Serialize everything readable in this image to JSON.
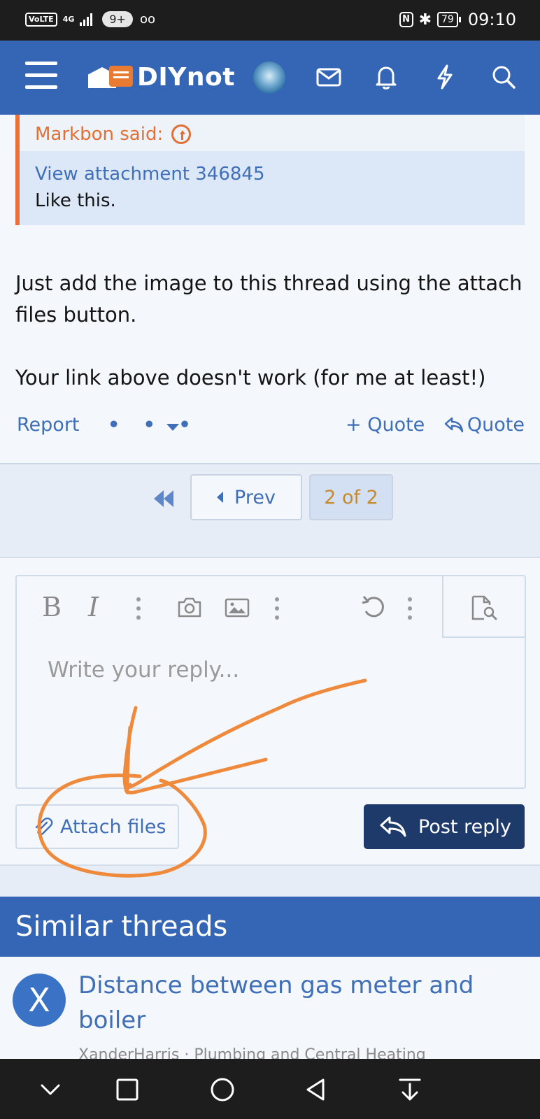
{
  "status_bar": {
    "volte": "VoLTE",
    "network": "4G",
    "notifications": "9+",
    "voicemail": "oo",
    "nfc": "N",
    "battery": "79",
    "time": "09:10"
  },
  "header": {
    "logo_text": "DIYnot",
    "icons": [
      "menu-icon",
      "avatar",
      "envelope-icon",
      "bell-icon",
      "lightning-icon",
      "search-icon"
    ]
  },
  "quote": {
    "author_line": "Markbon said:",
    "attachment_link": "View attachment 346845",
    "text": "Like this."
  },
  "post": {
    "paragraph1": "Just add the image to this thread using the attach files button.",
    "paragraph2": "Your link above doesn't work (for me at least!)"
  },
  "actions": {
    "report": "Report",
    "more": "• • •",
    "multi_quote": "+ Quote",
    "quote": "Quote"
  },
  "pagination": {
    "prev": "Prev",
    "current": "2 of 2"
  },
  "editor": {
    "bold": "B",
    "italic": "I",
    "placeholder": "Write your reply..."
  },
  "buttons": {
    "attach_files": "Attach files",
    "post_reply": "Post reply"
  },
  "similar_threads": {
    "heading": "Similar threads",
    "items": [
      {
        "avatar_letter": "X",
        "title": "Distance between gas meter and boiler",
        "meta": "XanderHarris · Plumbing and Central Heating"
      }
    ]
  },
  "colors": {
    "brand_blue": "#3566b5",
    "accent_orange": "#e87a32",
    "link_blue": "#3e6fb8",
    "post_button": "#1e3a6b",
    "annotation_orange": "#ef8a3c"
  }
}
